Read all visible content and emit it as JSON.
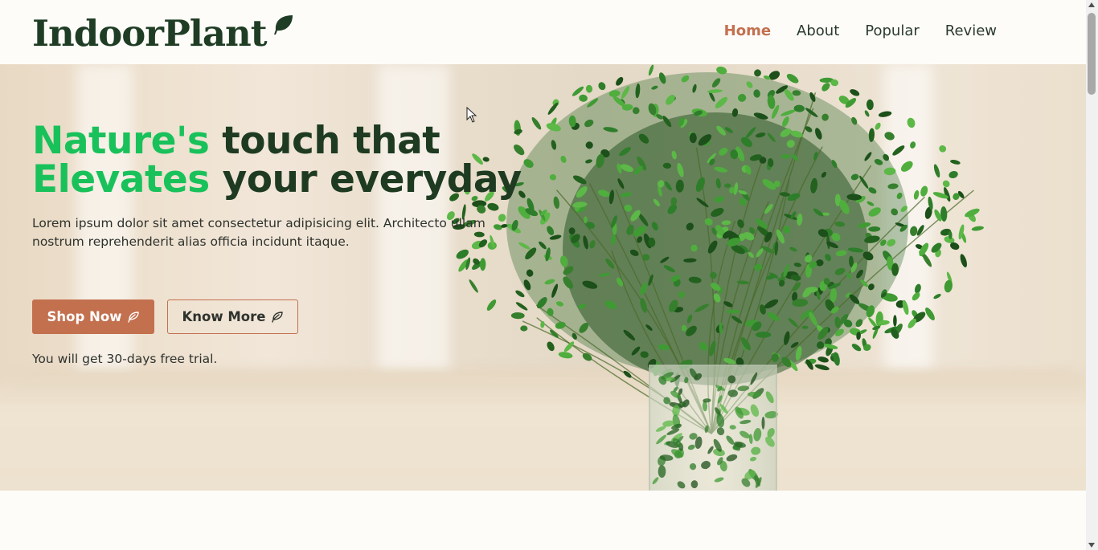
{
  "header": {
    "logo": "IndoorPlant",
    "logo_icon": "leaf-icon",
    "nav": [
      {
        "label": "Home",
        "active": true
      },
      {
        "label": "About",
        "active": false
      },
      {
        "label": "Popular",
        "active": false
      },
      {
        "label": "Review",
        "active": false
      }
    ]
  },
  "hero": {
    "title_line1_accent": "Nature's",
    "title_line1_rest": " touch that",
    "title_line2_accent": "Elevates",
    "title_line2_rest": " your everyday",
    "description": "Lorem ipsum dolor sit amet consectetur adipisicing elit. Architecto ullam nostrum reprehenderit alias officia incidunt itaque.",
    "shop_button": "Shop Now",
    "know_button": "Know More",
    "button_icon": "leaf-outline-icon",
    "trial_text": "You will get 30-days free trial."
  },
  "colors": {
    "accent": "#c3704f",
    "dark_green": "#1e3b22",
    "bright_green": "#19c15a"
  }
}
